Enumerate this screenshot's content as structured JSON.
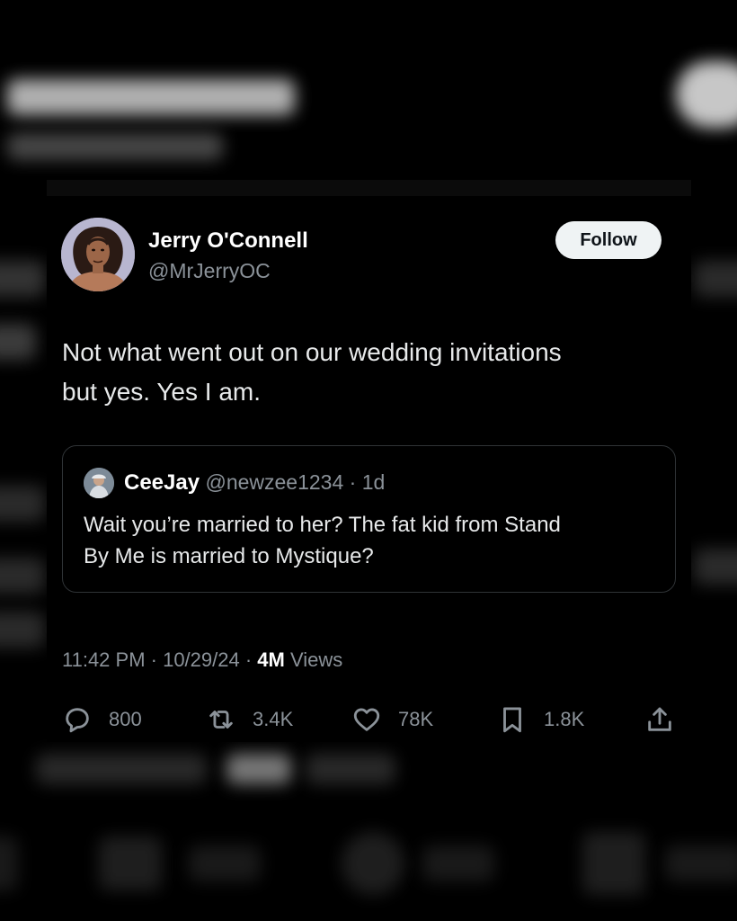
{
  "tweet": {
    "author_name": "Jerry O'Connell",
    "author_handle": "@MrJerryOC",
    "follow_label": "Follow",
    "text_line1": "Not what went out on our wedding invitations",
    "text_line2": "but yes.  Yes I am.",
    "timestamp": "11:42 PM · 10/29/24 · ",
    "views_count": "4M",
    "views_label": " Views"
  },
  "quote": {
    "name": "CeeJay",
    "meta": " @newzee1234 · 1d",
    "text_line1": "Wait you’re married to her? The fat kid from Stand",
    "text_line2": "By Me is married to Mystique?"
  },
  "actions": {
    "replies": "800",
    "reposts": "3.4K",
    "likes": "78K",
    "bookmarks": "1.8K"
  },
  "icons": [
    "reply-icon",
    "repost-icon",
    "like-icon",
    "bookmark-icon",
    "share-icon"
  ],
  "colors": {
    "background": "#000000",
    "text": "#e7e9ea",
    "muted": "#8b9299",
    "follow_bg": "#eff3f4",
    "border": "#2f3336"
  }
}
